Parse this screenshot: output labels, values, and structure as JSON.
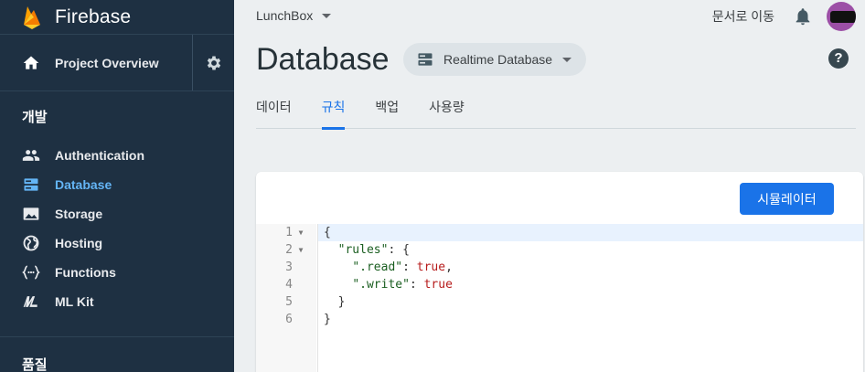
{
  "sidebar": {
    "brand": "Firebase",
    "overview_label": "Project Overview",
    "section_develop": "개발",
    "section_quality": "품질",
    "items": [
      {
        "label": "Authentication",
        "icon": "people-icon"
      },
      {
        "label": "Database",
        "icon": "database-icon",
        "active": true
      },
      {
        "label": "Storage",
        "icon": "image-icon"
      },
      {
        "label": "Hosting",
        "icon": "globe-icon"
      },
      {
        "label": "Functions",
        "icon": "functions-icon"
      },
      {
        "label": "ML Kit",
        "icon": "ml-kit-icon"
      }
    ]
  },
  "topbar": {
    "project": "LunchBox",
    "docs": "문서로 이동"
  },
  "page": {
    "title": "Database",
    "db_select": "Realtime Database",
    "tabs": [
      "데이터",
      "규칙",
      "백업",
      "사용량"
    ],
    "active_tab": "규칙"
  },
  "rules": {
    "simulator_button": "시뮬레이터",
    "line_numbers": [
      "1",
      "2",
      "3",
      "4",
      "5",
      "6"
    ],
    "lines": [
      "{",
      "  \"rules\": {",
      "    \".read\": true,",
      "    \".write\": true",
      "  }",
      "}"
    ]
  },
  "colors": {
    "sidebar_bg": "#1e3042",
    "accent": "#1a73e8",
    "active_nav": "#64b5f6"
  }
}
